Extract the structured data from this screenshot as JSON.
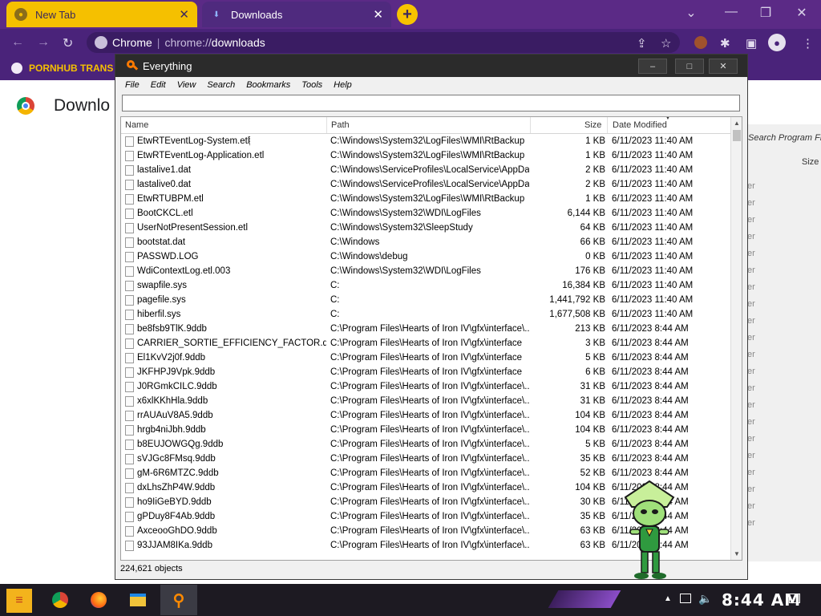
{
  "browser": {
    "tabs": [
      {
        "title": "New Tab",
        "active": false
      },
      {
        "title": "Downloads",
        "active": true
      }
    ],
    "new_tab_glyph": "+",
    "window_controls": {
      "minimize": "⌄",
      "restore": "❐",
      "close": "✕"
    },
    "address": {
      "site_label": "Chrome",
      "scheme": "chrome://",
      "path": "downloads"
    },
    "bookmark": {
      "label": "PORNHUB TRANS"
    },
    "page_heading": "Downlo",
    "accent": "#5b2a86",
    "tab_highlight": "#f5c000"
  },
  "background_window": {
    "search_label": "Search Program File",
    "size_column": "Size",
    "row_suffix": "er"
  },
  "everything": {
    "title": "Everything",
    "window_buttons": {
      "minimize": "–",
      "maximize": "□",
      "close": "✕"
    },
    "menu": [
      "File",
      "Edit",
      "View",
      "Search",
      "Bookmarks",
      "Tools",
      "Help"
    ],
    "search_value": "",
    "columns": {
      "name": "Name",
      "path": "Path",
      "size": "Size",
      "date": "Date Modified"
    },
    "rows": [
      {
        "name": "EtwRTEventLog-System.etl",
        "path": "C:\\Windows\\System32\\LogFiles\\WMI\\RtBackup",
        "size": "1 KB",
        "date": "6/11/2023 11:40 AM"
      },
      {
        "name": "EtwRTEventLog-Application.etl",
        "path": "C:\\Windows\\System32\\LogFiles\\WMI\\RtBackup",
        "size": "1 KB",
        "date": "6/11/2023 11:40 AM"
      },
      {
        "name": "lastalive1.dat",
        "path": "C:\\Windows\\ServiceProfiles\\LocalService\\AppDat...",
        "size": "2 KB",
        "date": "6/11/2023 11:40 AM"
      },
      {
        "name": "lastalive0.dat",
        "path": "C:\\Windows\\ServiceProfiles\\LocalService\\AppDat...",
        "size": "2 KB",
        "date": "6/11/2023 11:40 AM"
      },
      {
        "name": "EtwRTUBPM.etl",
        "path": "C:\\Windows\\System32\\LogFiles\\WMI\\RtBackup",
        "size": "1 KB",
        "date": "6/11/2023 11:40 AM"
      },
      {
        "name": "BootCKCL.etl",
        "path": "C:\\Windows\\System32\\WDI\\LogFiles",
        "size": "6,144 KB",
        "date": "6/11/2023 11:40 AM"
      },
      {
        "name": "UserNotPresentSession.etl",
        "path": "C:\\Windows\\System32\\SleepStudy",
        "size": "64 KB",
        "date": "6/11/2023 11:40 AM"
      },
      {
        "name": "bootstat.dat",
        "path": "C:\\Windows",
        "size": "66 KB",
        "date": "6/11/2023 11:40 AM"
      },
      {
        "name": "PASSWD.LOG",
        "path": "C:\\Windows\\debug",
        "size": "0 KB",
        "date": "6/11/2023 11:40 AM"
      },
      {
        "name": "WdiContextLog.etl.003",
        "path": "C:\\Windows\\System32\\WDI\\LogFiles",
        "size": "176 KB",
        "date": "6/11/2023 11:40 AM"
      },
      {
        "name": "swapfile.sys",
        "path": "C:",
        "size": "16,384 KB",
        "date": "6/11/2023 11:40 AM"
      },
      {
        "name": "pagefile.sys",
        "path": "C:",
        "size": "1,441,792 KB",
        "date": "6/11/2023 11:40 AM"
      },
      {
        "name": "hiberfil.sys",
        "path": "C:",
        "size": "1,677,508 KB",
        "date": "6/11/2023 11:40 AM"
      },
      {
        "name": "be8fsb9TlK.9ddb",
        "path": "C:\\Program Files\\Hearts of Iron IV\\gfx\\interface\\...",
        "size": "213 KB",
        "date": "6/11/2023 8:44 AM"
      },
      {
        "name": "CARRIER_SORTIE_EFFICIENCY_FACTOR.dds",
        "path": "C:\\Program Files\\Hearts of Iron IV\\gfx\\interface",
        "size": "3 KB",
        "date": "6/11/2023 8:44 AM"
      },
      {
        "name": "El1KvV2j0f.9ddb",
        "path": "C:\\Program Files\\Hearts of Iron IV\\gfx\\interface",
        "size": "5 KB",
        "date": "6/11/2023 8:44 AM"
      },
      {
        "name": "JKFHPJ9Vpk.9ddb",
        "path": "C:\\Program Files\\Hearts of Iron IV\\gfx\\interface",
        "size": "6 KB",
        "date": "6/11/2023 8:44 AM"
      },
      {
        "name": "J0RGmkCILC.9ddb",
        "path": "C:\\Program Files\\Hearts of Iron IV\\gfx\\interface\\...",
        "size": "31 KB",
        "date": "6/11/2023 8:44 AM"
      },
      {
        "name": "x6xlKKhHla.9ddb",
        "path": "C:\\Program Files\\Hearts of Iron IV\\gfx\\interface\\...",
        "size": "31 KB",
        "date": "6/11/2023 8:44 AM"
      },
      {
        "name": "rrAUAuV8A5.9ddb",
        "path": "C:\\Program Files\\Hearts of Iron IV\\gfx\\interface\\...",
        "size": "104 KB",
        "date": "6/11/2023 8:44 AM"
      },
      {
        "name": "hrgb4niJbh.9ddb",
        "path": "C:\\Program Files\\Hearts of Iron IV\\gfx\\interface\\...",
        "size": "104 KB",
        "date": "6/11/2023 8:44 AM"
      },
      {
        "name": "b8EUJOWGQg.9ddb",
        "path": "C:\\Program Files\\Hearts of Iron IV\\gfx\\interface\\...",
        "size": "5 KB",
        "date": "6/11/2023 8:44 AM"
      },
      {
        "name": "sVJGc8FMsq.9ddb",
        "path": "C:\\Program Files\\Hearts of Iron IV\\gfx\\interface\\...",
        "size": "35 KB",
        "date": "6/11/2023 8:44 AM"
      },
      {
        "name": "gM-6R6MTZC.9ddb",
        "path": "C:\\Program Files\\Hearts of Iron IV\\gfx\\interface\\...",
        "size": "52 KB",
        "date": "6/11/2023 8:44 AM"
      },
      {
        "name": "dxLhsZhP4W.9ddb",
        "path": "C:\\Program Files\\Hearts of Iron IV\\gfx\\interface\\...",
        "size": "104 KB",
        "date": "6/11/2023 8:44 AM"
      },
      {
        "name": "ho9IiGeBYD.9ddb",
        "path": "C:\\Program Files\\Hearts of Iron IV\\gfx\\interface\\...",
        "size": "30 KB",
        "date": "6/11/2023 8:44 AM"
      },
      {
        "name": "gPDuy8F4Ab.9ddb",
        "path": "C:\\Program Files\\Hearts of Iron IV\\gfx\\interface\\...",
        "size": "35 KB",
        "date": "6/11/2023 8:44 AM"
      },
      {
        "name": "AxceooGhDO.9ddb",
        "path": "C:\\Program Files\\Hearts of Iron IV\\gfx\\interface\\...",
        "size": "63 KB",
        "date": "6/11/2023 8:44 AM"
      },
      {
        "name": "93JJAM8IKa.9ddb",
        "path": "C:\\Program Files\\Hearts of Iron IV\\gfx\\interface\\...",
        "size": "63 KB",
        "date": "6/11/2023 8:44 AM"
      }
    ],
    "status": "224,621 objects"
  },
  "taskbar": {
    "clock": "8:44 AM",
    "apps": [
      "start-button",
      "chrome-icon",
      "firefox-icon",
      "file-explorer-icon",
      "everything-icon"
    ]
  }
}
